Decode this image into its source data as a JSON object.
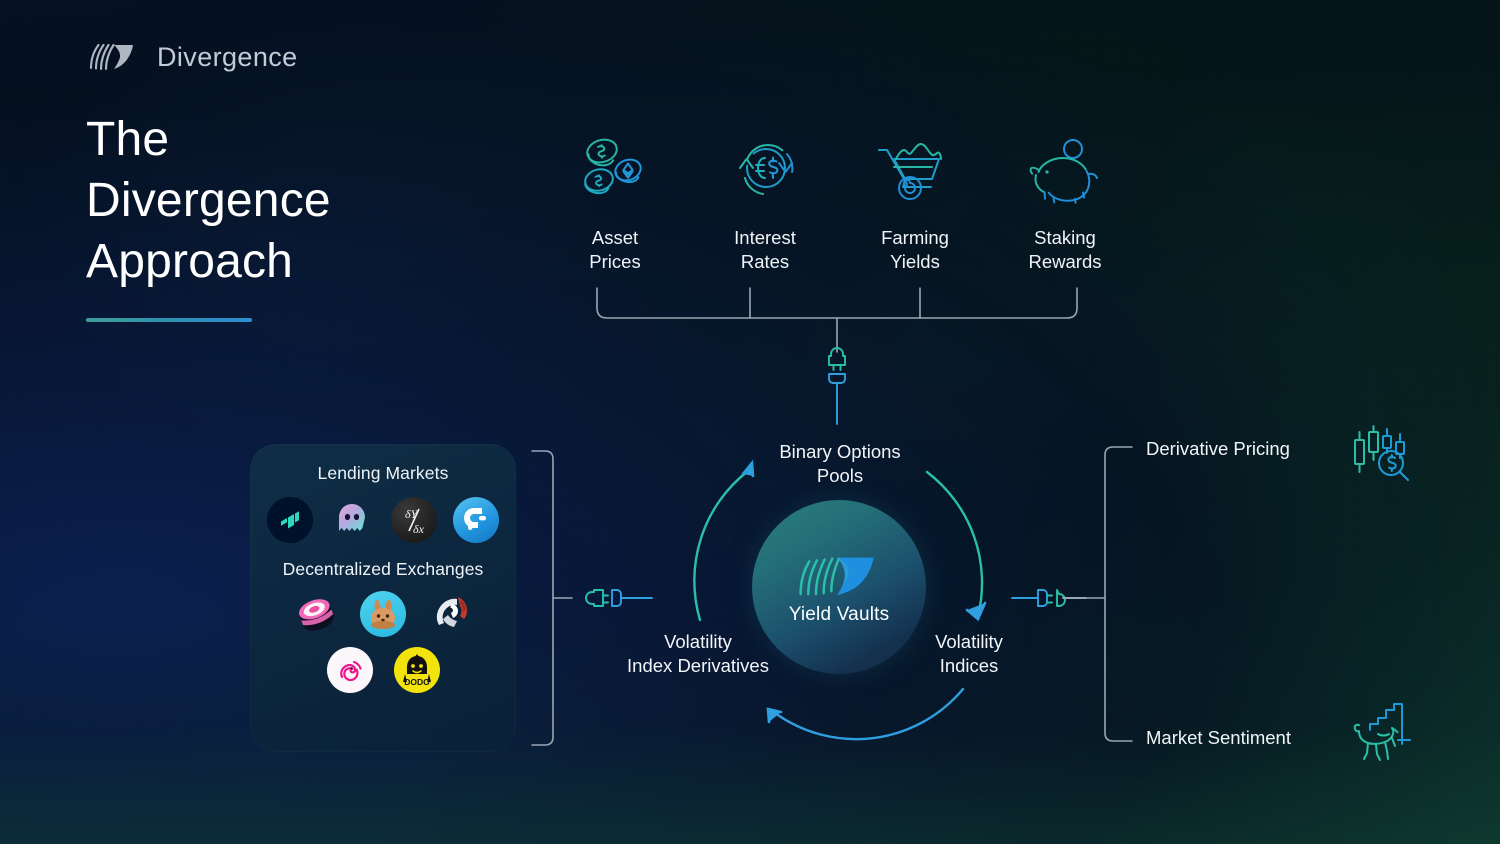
{
  "brand": {
    "name": "Divergence",
    "logo_icon": "divergence-logo-icon"
  },
  "headline": {
    "line1": "The",
    "line2": "Divergence",
    "line3": "Approach"
  },
  "inputs": {
    "items": [
      {
        "label_line1": "Asset",
        "label_line2": "Prices",
        "icon": "crypto-coins-icon"
      },
      {
        "label_line1": "Interest",
        "label_line2": "Rates",
        "icon": "interest-rate-arrows-icon"
      },
      {
        "label_line1": "Farming",
        "label_line2": "Yields",
        "icon": "wheelbarrow-icon"
      },
      {
        "label_line1": "Staking",
        "label_line2": "Rewards",
        "icon": "piggy-bank-icon"
      }
    ]
  },
  "sources_card": {
    "lending_title": "Lending Markets",
    "lending_logos": [
      {
        "name": "compound-logo",
        "label": "Compound"
      },
      {
        "name": "aave-logo",
        "label": "Aave"
      },
      {
        "name": "dydx-logo",
        "label": "dYdX"
      },
      {
        "name": "cream-logo",
        "label": "Cream Finance"
      }
    ],
    "dex_title": "Decentralized Exchanges",
    "dex_logos": [
      {
        "name": "sushiswap-logo",
        "label": "SushiSwap"
      },
      {
        "name": "pancakeswap-logo",
        "label": "PancakeSwap"
      },
      {
        "name": "1inch-logo",
        "label": "1inch"
      },
      {
        "name": "uniswap-logo",
        "label": "Uniswap"
      },
      {
        "name": "dodo-logo",
        "label": "DODO"
      }
    ]
  },
  "core": {
    "label": "Yield Vaults",
    "logo_icon": "divergence-mark-icon",
    "ring_top": "Binary Options\nPools",
    "ring_top_line1": "Binary Options",
    "ring_top_line2": "Pools",
    "ring_left_line1": "Volatility",
    "ring_left_line2": "Index Derivatives",
    "ring_right_line1": "Volatility",
    "ring_right_line2": "Indices"
  },
  "outputs": {
    "items": [
      {
        "label": "Derivative Pricing",
        "icon": "candlestick-search-icon"
      },
      {
        "label": "Market Sentiment",
        "icon": "bull-chart-icon"
      }
    ]
  },
  "colors": {
    "accent_blue": "#2f9fe0",
    "accent_teal": "#2bbfa8",
    "bracket_grey": "#9aa6b2",
    "text_primary": "#f2f5f9",
    "background_deep": "#050b16",
    "card_fill": "#10304a",
    "rule_gradient_start": "#3f9e94",
    "rule_gradient_end": "#2f8fd6"
  }
}
